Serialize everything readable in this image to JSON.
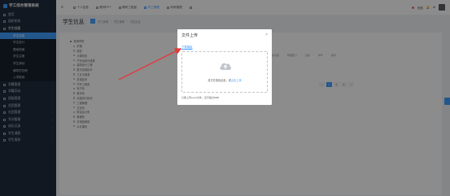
{
  "app": {
    "title": "学工综合管理系统"
  },
  "sidebar": {
    "items_top": [
      {
        "label": "首页"
      },
      {
        "label": "组织机构"
      },
      {
        "label": "学生档案",
        "open": true
      }
    ],
    "sub_items": [
      {
        "label": "学生信息",
        "active": true
      },
      {
        "label": "学生统计"
      },
      {
        "label": "基础档案"
      },
      {
        "label": "学生注册"
      },
      {
        "label": "学生调动"
      },
      {
        "label": "辅导员任职"
      },
      {
        "label": "入学报到"
      }
    ],
    "items_bottom": [
      {
        "label": "学籍管理"
      },
      {
        "label": "学籍异动"
      },
      {
        "label": "班级管理"
      },
      {
        "label": "党团管理"
      },
      {
        "label": "社团管理"
      },
      {
        "label": "军训管理"
      },
      {
        "label": "成长记录"
      },
      {
        "label": "学生请假"
      },
      {
        "label": "学生离校"
      }
    ]
  },
  "topbar": {
    "tabs": [
      {
        "label": "个人信息"
      },
      {
        "label": "教师PPT"
      },
      {
        "label": "教研工程量"
      },
      {
        "label": "学工管理",
        "active": true
      },
      {
        "label": "科研管理"
      }
    ],
    "status": "在线"
  },
  "page": {
    "title": "学生信息",
    "crumbs": [
      "学工管理",
      "学生管理",
      "学生信息"
    ]
  },
  "tree": {
    "root": "常德学院",
    "children": [
      "护理",
      "康复",
      "计算机系",
      "汽车运用与维修",
      "建筑设计工程",
      "数字控制技术",
      "工业与旅游",
      "机电技术",
      "汽车工程系",
      "电子系",
      "美术系",
      "动漫设计技术",
      "工程管理",
      "文化系",
      "财会会计系",
      "管理系",
      "市场营销系",
      "公共课系"
    ]
  },
  "table": {
    "headers": [
      "学院/系部",
      "所属部门",
      "班级",
      "学号",
      "操作"
    ]
  },
  "pager": {
    "pages": [
      "1",
      "2",
      "3"
    ],
    "current": "1"
  },
  "dialog": {
    "title": "文件上传",
    "close": "×",
    "template_link": "下载模板",
    "drop_text": "将文件拖到此处，或",
    "drop_link": "点击上传",
    "tip": "只能上传excel文件，且不超过5MB"
  },
  "colors": {
    "accent": "#409eff",
    "sidebar": "#1f2d3d",
    "arrow": "#e23b3b"
  }
}
